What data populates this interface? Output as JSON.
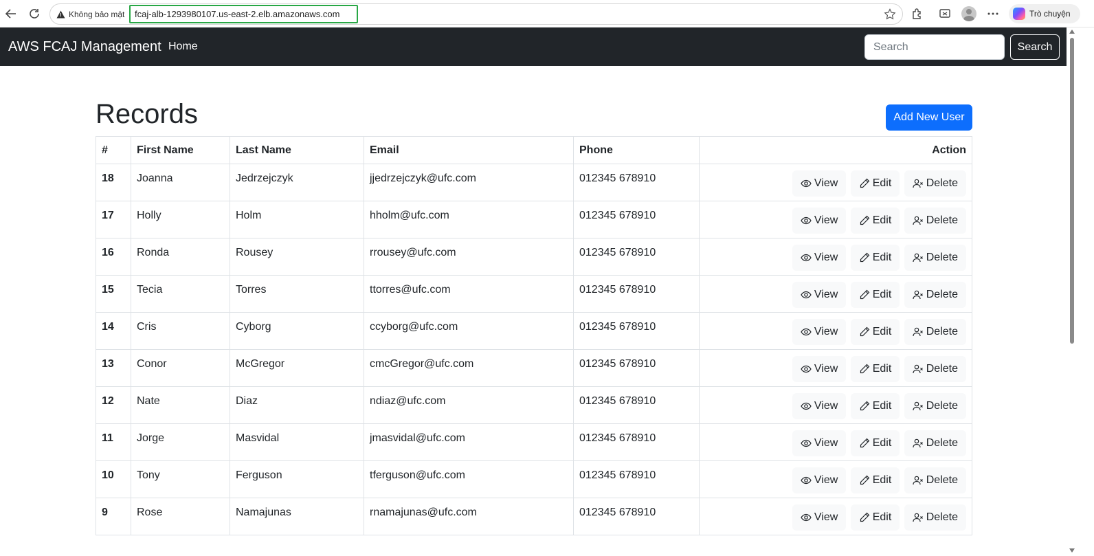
{
  "browser": {
    "security_label": "Không bảo mật",
    "url": "fcaj-alb-1293980107.us-east-2.elb.amazonaws.com",
    "copilot_label": "Trò chuyện"
  },
  "navbar": {
    "brand": "AWS FCAJ Management",
    "home_label": "Home",
    "search_placeholder": "Search",
    "search_button": "Search"
  },
  "page": {
    "title": "Records",
    "add_button": "Add New User"
  },
  "table": {
    "headers": [
      "#",
      "First Name",
      "Last Name",
      "Email",
      "Phone",
      "Action"
    ],
    "actions": {
      "view": "View",
      "edit": "Edit",
      "delete": "Delete"
    },
    "rows": [
      {
        "id": "18",
        "first": "Joanna",
        "last": "Jedrzejczyk",
        "email": "jjedrzejczyk@ufc.com",
        "phone": "012345 678910"
      },
      {
        "id": "17",
        "first": "Holly",
        "last": "Holm",
        "email": "hholm@ufc.com",
        "phone": "012345 678910"
      },
      {
        "id": "16",
        "first": "Ronda",
        "last": "Rousey",
        "email": "rrousey@ufc.com",
        "phone": "012345 678910"
      },
      {
        "id": "15",
        "first": "Tecia",
        "last": "Torres",
        "email": "ttorres@ufc.com",
        "phone": "012345 678910"
      },
      {
        "id": "14",
        "first": "Cris",
        "last": "Cyborg",
        "email": "ccyborg@ufc.com",
        "phone": "012345 678910"
      },
      {
        "id": "13",
        "first": "Conor",
        "last": "McGregor",
        "email": "cmcGregor@ufc.com",
        "phone": "012345 678910"
      },
      {
        "id": "12",
        "first": "Nate",
        "last": "Diaz",
        "email": "ndiaz@ufc.com",
        "phone": "012345 678910"
      },
      {
        "id": "11",
        "first": "Jorge",
        "last": "Masvidal",
        "email": "jmasvidal@ufc.com",
        "phone": "012345 678910"
      },
      {
        "id": "10",
        "first": "Tony",
        "last": "Ferguson",
        "email": "tferguson@ufc.com",
        "phone": "012345 678910"
      },
      {
        "id": "9",
        "first": "Rose",
        "last": "Namajunas",
        "email": "rnamajunas@ufc.com",
        "phone": "012345 678910"
      }
    ]
  },
  "colors": {
    "navbar_bg": "#212529",
    "primary": "#0d6efd",
    "url_highlight": "#28a745",
    "action_button_bg": "#f8f9fa"
  },
  "icons": {
    "view": "eye-icon",
    "edit": "pencil-icon",
    "delete": "person-x-icon"
  }
}
